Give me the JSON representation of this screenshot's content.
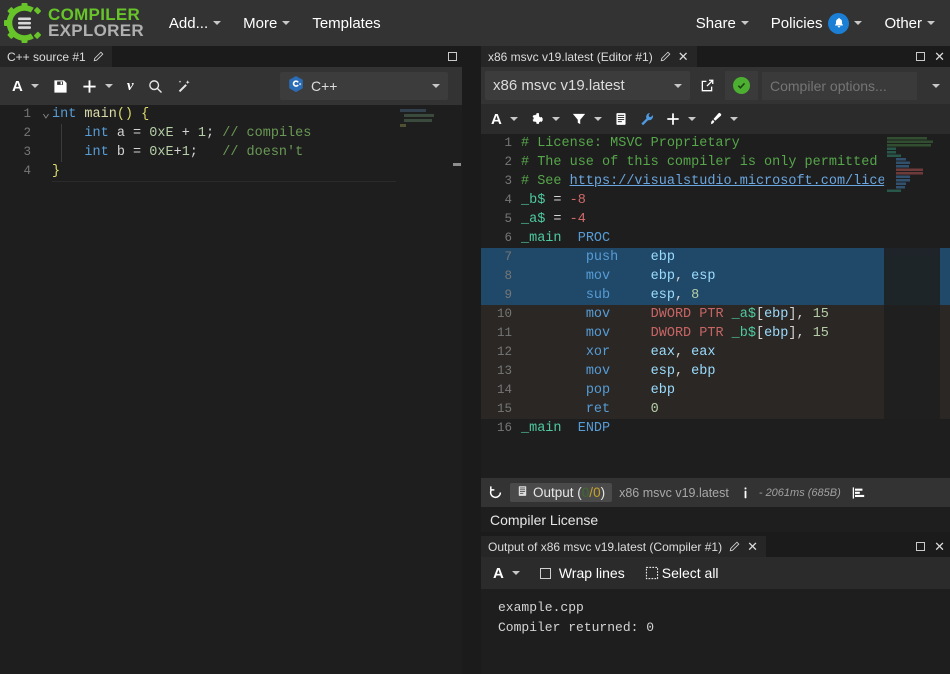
{
  "brand": {
    "line1": "COMPILER",
    "line2": "EXPLORER",
    "logo_icon": "gear-logo-icon"
  },
  "navbar": {
    "left_items": [
      {
        "label": "Add...",
        "caret": true
      },
      {
        "label": "More",
        "caret": true
      },
      {
        "label": "Templates",
        "caret": false
      }
    ],
    "right_items": [
      {
        "label": "Share",
        "caret": true,
        "badge": false
      },
      {
        "label": "Policies",
        "caret": true,
        "badge": true,
        "badge_icon": "bell-icon",
        "badge_color": "#1c7fd6"
      },
      {
        "label": "Other",
        "caret": true,
        "badge": false
      }
    ]
  },
  "editor_pane": {
    "tab_title": "C++ source #1",
    "edit_icon": "pencil-icon",
    "maximize_icon": "maximize-icon",
    "toolbar": [
      {
        "name": "font-size-button",
        "glyph": "A",
        "caret": true
      },
      {
        "name": "save-button",
        "glyph": "floppy-icon",
        "caret": false
      },
      {
        "name": "add-tool-button",
        "glyph": "plus-icon",
        "caret": true
      },
      {
        "name": "vim-mode-button",
        "glyph": "vim-icon",
        "caret": false
      },
      {
        "name": "search-button",
        "glyph": "magnifier-icon",
        "caret": false
      },
      {
        "name": "format-button",
        "glyph": "wand-icon",
        "caret": false
      }
    ],
    "language_select": {
      "value": "C++",
      "icon": "cpp-logo-icon"
    },
    "lines": [
      {
        "n": "1",
        "fold": "v",
        "html": "<span class=\"kw\">int</span> <span class=\"fn\">main</span><span class=\"punct\">()</span> <span class=\"punct\">{</span>"
      },
      {
        "n": "2",
        "fold": "",
        "html": "    <span class=\"kw\">int</span> <span class=\"op\">a</span> <span class=\"op\">=</span> <span class=\"num\">0xE</span> <span class=\"op\">+</span> <span class=\"num\">1</span><span class=\"op\">;</span> <span class=\"cmt\">// compiles</span>"
      },
      {
        "n": "3",
        "fold": "",
        "html": "    <span class=\"kw\">int</span> <span class=\"op\">b</span> <span class=\"op\">=</span> <span class=\"num\">0xE</span><span class=\"op\">+</span><span class=\"num\">1</span><span class=\"op\">;</span>   <span class=\"cmt\">// doesn't</span>"
      },
      {
        "n": "4",
        "fold": "",
        "html": "<span class=\"punct\">}</span>",
        "current": true
      }
    ],
    "plain_lines": [
      "int main() {",
      "    int a = 0xE + 1; // compiles",
      "    int b = 0xE+1;   // doesn't",
      "}"
    ]
  },
  "compiler_pane": {
    "tab_title": "x86 msvc v19.latest (Editor #1)",
    "edit_icon": "pencil-icon",
    "close_icon": "close-icon",
    "maximize_icon": "maximize-icon",
    "compiler_select": "x86 msvc v19.latest",
    "popout_icon": "external-link-icon",
    "status": {
      "icon": "check-circle-icon",
      "color": "#4caf32"
    },
    "options_placeholder": "Compiler options...",
    "options_value": "",
    "options_caret_icon": "chevron-down-icon",
    "toolbar": [
      {
        "name": "font-size-button",
        "glyph": "A",
        "caret": true
      },
      {
        "name": "compiler-settings-button",
        "glyph": "gear-icon",
        "caret": true
      },
      {
        "name": "output-filters-button",
        "glyph": "filter-icon",
        "caret": true
      },
      {
        "name": "libraries-button",
        "glyph": "book-icon",
        "caret": false
      },
      {
        "name": "tools-button",
        "glyph": "wrench-icon",
        "caret": false
      },
      {
        "name": "add-view-button",
        "glyph": "plus-icon",
        "caret": true
      },
      {
        "name": "color-button",
        "glyph": "paintbrush-icon",
        "caret": true
      }
    ],
    "asm_lines": [
      {
        "n": "1",
        "hl": "",
        "html": "<span class=\"asmcmt\"># License: MSVC Proprietary</span>"
      },
      {
        "n": "2",
        "hl": "",
        "html": "<span class=\"asmcmt\"># The use of this compiler is only permitted</span>"
      },
      {
        "n": "3",
        "hl": "",
        "html": "<span class=\"asmcmt\"># See </span><span class=\"lnk\">https://visualstudio.microsoft.com/lice</span>"
      },
      {
        "n": "4",
        "hl": "",
        "html": "<span class=\"asmlbl\">_b$</span> <span class=\"white\">=</span> <span class=\"asmnum\">-8</span>"
      },
      {
        "n": "5",
        "hl": "",
        "html": "<span class=\"asmlbl\">_a$</span> <span class=\"white\">=</span> <span class=\"asmnum\">-4</span>"
      },
      {
        "n": "6",
        "hl": "",
        "html": "<span class=\"asmlbl\">_main</span>  <span class=\"opc\">PROC</span>"
      },
      {
        "n": "7",
        "hl": "hl-blue",
        "html": "        <span class=\"opc\">push</span>    <span class=\"reg\">ebp</span>"
      },
      {
        "n": "8",
        "hl": "hl-blue",
        "html": "        <span class=\"opc\">mov</span>     <span class=\"reg\">ebp</span><span class=\"white\">,</span> <span class=\"reg\">esp</span>"
      },
      {
        "n": "9",
        "hl": "hl-blue",
        "html": "        <span class=\"opc\">sub</span>     <span class=\"reg\">esp</span><span class=\"white\">,</span> <span class=\"num\">8</span>"
      },
      {
        "n": "10",
        "hl": "hl-dark",
        "html": "        <span class=\"opc\">mov</span>     <span class=\"ptr\">DWORD PTR </span><span class=\"asmlbl\">_a$</span><span class=\"white\">[</span><span class=\"reg\">ebp</span><span class=\"white\">],</span> <span class=\"num\">15</span>"
      },
      {
        "n": "11",
        "hl": "hl-dark",
        "html": "        <span class=\"opc\">mov</span>     <span class=\"ptr\">DWORD PTR </span><span class=\"asmlbl\">_b$</span><span class=\"white\">[</span><span class=\"reg\">ebp</span><span class=\"white\">],</span> <span class=\"num\">15</span>"
      },
      {
        "n": "12",
        "hl": "hl-dark",
        "html": "        <span class=\"opc\">xor</span>     <span class=\"reg\">eax</span><span class=\"white\">,</span> <span class=\"reg\">eax</span>"
      },
      {
        "n": "13",
        "hl": "hl-dark",
        "html": "        <span class=\"opc\">mov</span>     <span class=\"reg\">esp</span><span class=\"white\">,</span> <span class=\"reg\">ebp</span>"
      },
      {
        "n": "14",
        "hl": "hl-dark",
        "html": "        <span class=\"opc\">pop</span>     <span class=\"reg\">ebp</span>"
      },
      {
        "n": "15",
        "hl": "hl-dark",
        "html": "        <span class=\"opc\">ret</span>     <span class=\"num\">0</span>"
      },
      {
        "n": "16",
        "hl": "",
        "html": "<span class=\"asmlbl\">_main</span>  <span class=\"opc\">ENDP</span>"
      }
    ],
    "asm_plain": [
      "# License: MSVC Proprietary",
      "# The use of this compiler is only permitted",
      "# See https://visualstudio.microsoft.com/lice",
      "_b$ = -8",
      "_a$ = -4",
      "_main  PROC",
      "        push    ebp",
      "        mov     ebp, esp",
      "        sub     esp, 8",
      "        mov     DWORD PTR _a$[ebp], 15",
      "        mov     DWORD PTR _b$[ebp], 15",
      "        xor     eax, eax",
      "        mov     esp, ebp",
      "        pop     ebp",
      "        ret     0",
      "_main  ENDP"
    ],
    "status_bar": {
      "reload_icon": "refresh-icon",
      "output_label": "Output (",
      "output_errors": "0",
      "output_sep": "/",
      "output_warnings": "0",
      "output_close": ")",
      "output_icon": "list-icon",
      "compiler_name": "x86 msvc v19.latest",
      "info_icon": "info-icon",
      "timing": "- 2061ms (685B)",
      "stats_icon": "bar-chart-icon"
    },
    "license_text": "Compiler License"
  },
  "output_pane": {
    "tab_title": "Output of x86 msvc v19.latest (Compiler #1)",
    "edit_icon": "pencil-icon",
    "close_icon": "close-icon",
    "maximize_icon": "maximize-icon",
    "toolbar": {
      "font_glyph": "A",
      "wrap_label": "Wrap lines",
      "wrap_checked": false,
      "select_all_label": "Select all",
      "select_all_icon": "select-all-icon"
    },
    "lines": [
      "example.cpp",
      "Compiler returned: 0"
    ],
    "body": "example.cpp\nCompiler returned: 0"
  },
  "colors": {
    "navbar_bg": "#333333",
    "pane_bg": "#1e1e1e",
    "toolbar_bg": "#333333",
    "brand_green": "#67c52a",
    "accent_blue": "#1c7fd6",
    "success_green": "#4caf32",
    "highlight_blue": "#204969"
  }
}
